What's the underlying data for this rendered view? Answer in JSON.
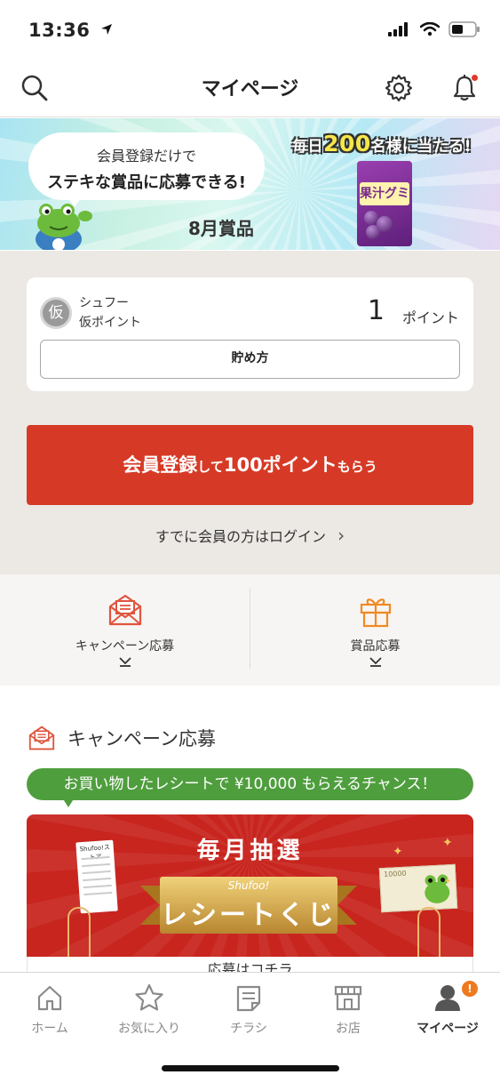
{
  "status_bar": {
    "time": "13:36"
  },
  "header": {
    "title": "マイページ"
  },
  "banner": {
    "bubble_line1": "会員登録だけで",
    "bubble_line2": "ステキな賞品に応募できる!",
    "month_prize": "8月賞品",
    "daily_prefix": "毎日",
    "daily_number": "200",
    "daily_suffix": "名様に当たる!",
    "product_name": "果汁グミ"
  },
  "points_card": {
    "badge": "仮",
    "label1": "シュフー",
    "label2": "仮ポイント",
    "value": "1",
    "unit": "ポイント",
    "howto_label": "貯め方"
  },
  "register": {
    "part1": "会員登録",
    "part2": "して",
    "part3": "100ポイント",
    "part4": "もらう"
  },
  "login_link": {
    "label": "すでに会員の方はログイン",
    "chevron": "›"
  },
  "quick_menu": {
    "items": [
      {
        "label": "キャンペーン応募"
      },
      {
        "label": "賞品応募"
      }
    ]
  },
  "campaign": {
    "heading": "キャンペーン応募",
    "promo": "お買い物したレシートで ¥10,000 もらえるチャンス！",
    "lottery_monthly": "毎月抽選",
    "lottery_brand": "Shufoo!",
    "lottery_title": "レシートくじ",
    "receipt_brand": "Shufoo!ストア",
    "bill_amount": "10000",
    "cta_label": "応募はコチラ"
  },
  "tab_bar": {
    "items": [
      {
        "label": "ホーム"
      },
      {
        "label": "お気に入り"
      },
      {
        "label": "チラシ"
      },
      {
        "label": "お店"
      },
      {
        "label": "マイページ"
      }
    ],
    "active_index": 4,
    "mypage_badge": "!"
  },
  "colors": {
    "accent_red": "#d63a26",
    "promo_green": "#4f9e3e",
    "badge_orange": "#ef7a1e"
  }
}
